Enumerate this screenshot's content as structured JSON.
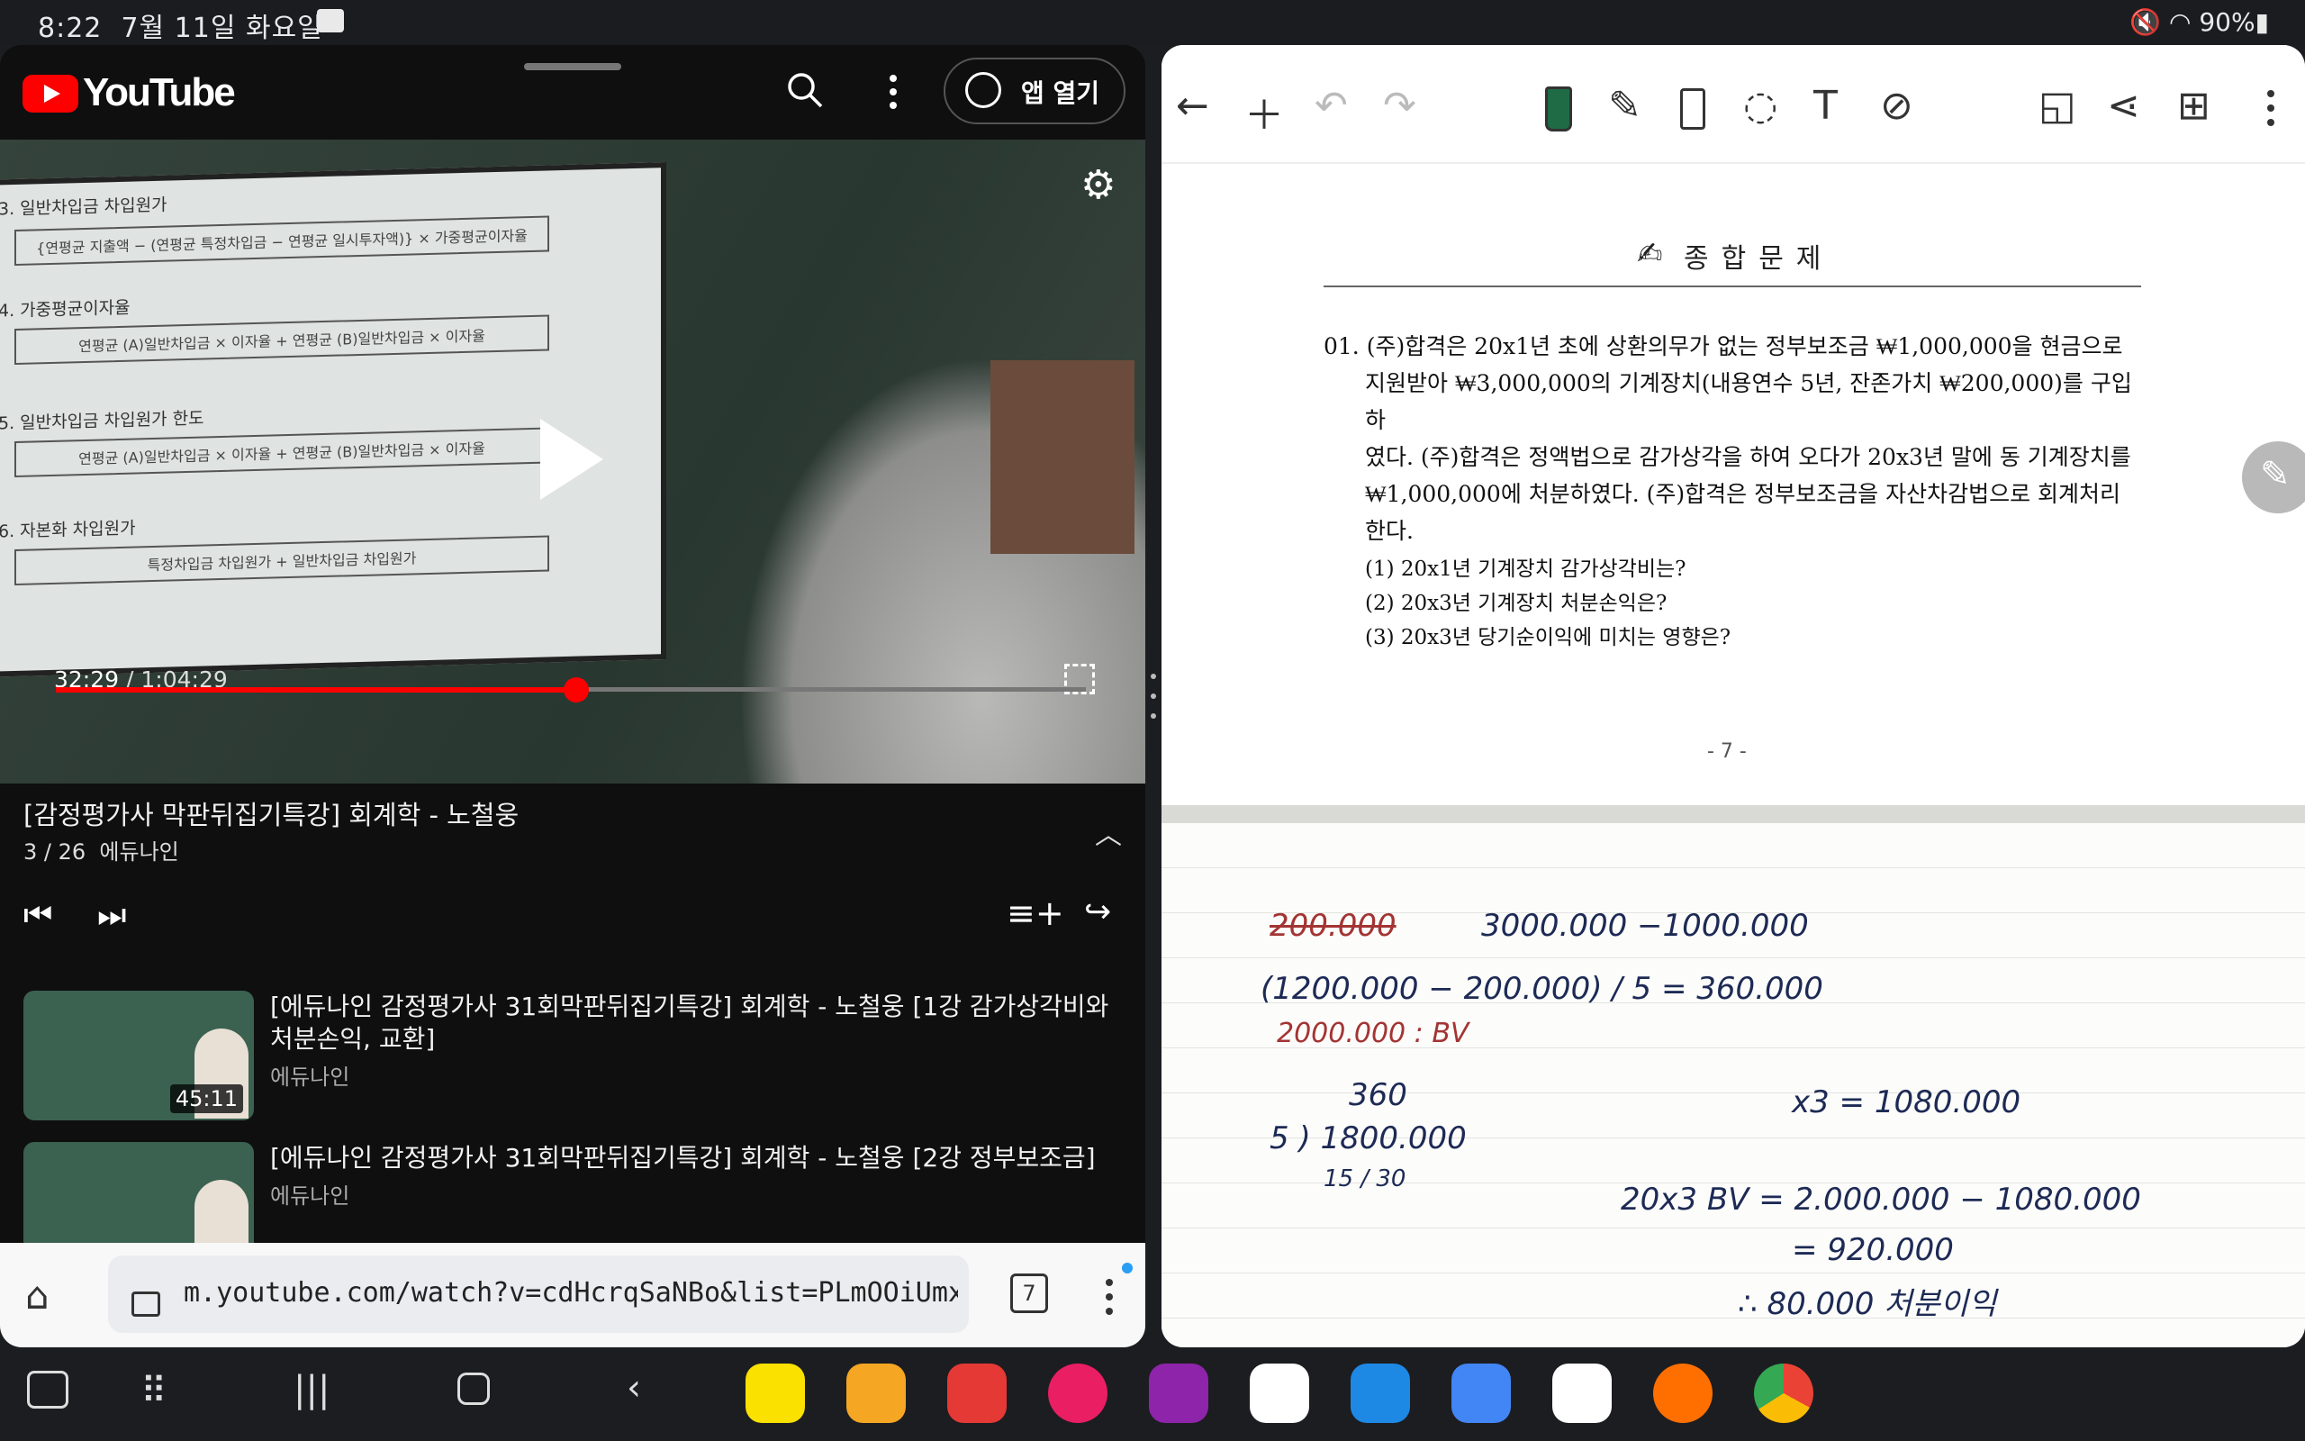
{
  "status_bar": {
    "time": "8:22",
    "date": "7월 11일 화요일",
    "battery": "90%"
  },
  "youtube": {
    "logo_text": "YouTube",
    "open_app_label": "앱 열기",
    "video": {
      "current_time": "32:29",
      "separator": " / ",
      "duration": "1:04:29",
      "progress_fraction": 0.505,
      "slide_lines": [
        "3. 일반차입금 차입원가",
        "4. 가중평균이자율",
        "5. 일반차입금 차입원가 한도",
        "6. 자본화 차입원가"
      ],
      "slide_boxes": [
        "{연평균 지출액 − (연평균 특정차입금 − 연평균 일시투자액)} × 가중평균이자율",
        "연평균 (A)일반차입금 × 이자율 + 연평균 (B)일반차입금 × 이자율",
        "연평균 (A)일반차입금 × 이자율 + 연평균 (B)일반차입금 × 이자율",
        "특정차입금 차입원가 + 일반차입금 차입원가"
      ]
    },
    "playlist_title": "[감정평가사 막판뒤집기특강] 회계학 - 노철웅",
    "playlist_position": "3 / 26",
    "channel": "에듀나인",
    "items": [
      {
        "title": "[에듀나인 감정평가사 31회막판뒤집기특강] 회계학 - 노철웅 [1강 감가상각비와 처분손익, 교환]",
        "channel": "에듀나인",
        "duration": "45:11"
      },
      {
        "title": "[에듀나인 감정평가사 31회막판뒤집기특강] 회계학 - 노철웅 [2강 정부보조금]",
        "channel": "에듀나인",
        "duration": ""
      }
    ]
  },
  "browser": {
    "url": "m.youtube.com/watch?v=cdHcrqSaNBo&list=PLmOOiUmxVVPEtm",
    "tab_count": "7"
  },
  "notes": {
    "heading": "종합문제",
    "question_lines": [
      "01. (주)합격은 20x1년 초에 상환의무가 없는 정부보조금 ₩1,000,000을 현금으로",
      "지원받아 ₩3,000,000의 기계장치(내용연수 5년, 잔존가치 ₩200,000)를 구입하",
      "였다. (주)합격은 정액법으로 감가상각을 하여 오다가 20x3년 말에 동 기계장치를",
      "₩1,000,000에 처분하였다. (주)합격은 정부보조금을 자산차감법으로 회계처리",
      "한다."
    ],
    "sub_questions": [
      "(1) 20x1년 기계장치 감가상각비는?",
      "(2) 20x3년 기계장치 처분손익은?",
      "(3) 20x3년 당기순이익에 미치는 영향은?"
    ],
    "page_number": "- 7 -",
    "handwriting": [
      "3000.000 −1000.000",
      "(1200.000 − 200.000) / 5 = 360.000",
      "2000.000 : BV",
      "360",
      "5 ) 1800.000",
      "15 / 30",
      "x3 = 1080.000",
      "20x3 BV = 2.000.000 − 1080.000",
      "= 920.000",
      "∴ 80.000  처분이익"
    ],
    "strikethrough": "200.000"
  },
  "colors": {
    "yt_red": "#ff0000",
    "ink": "#1d2a55",
    "red_ink": "#a33434"
  }
}
